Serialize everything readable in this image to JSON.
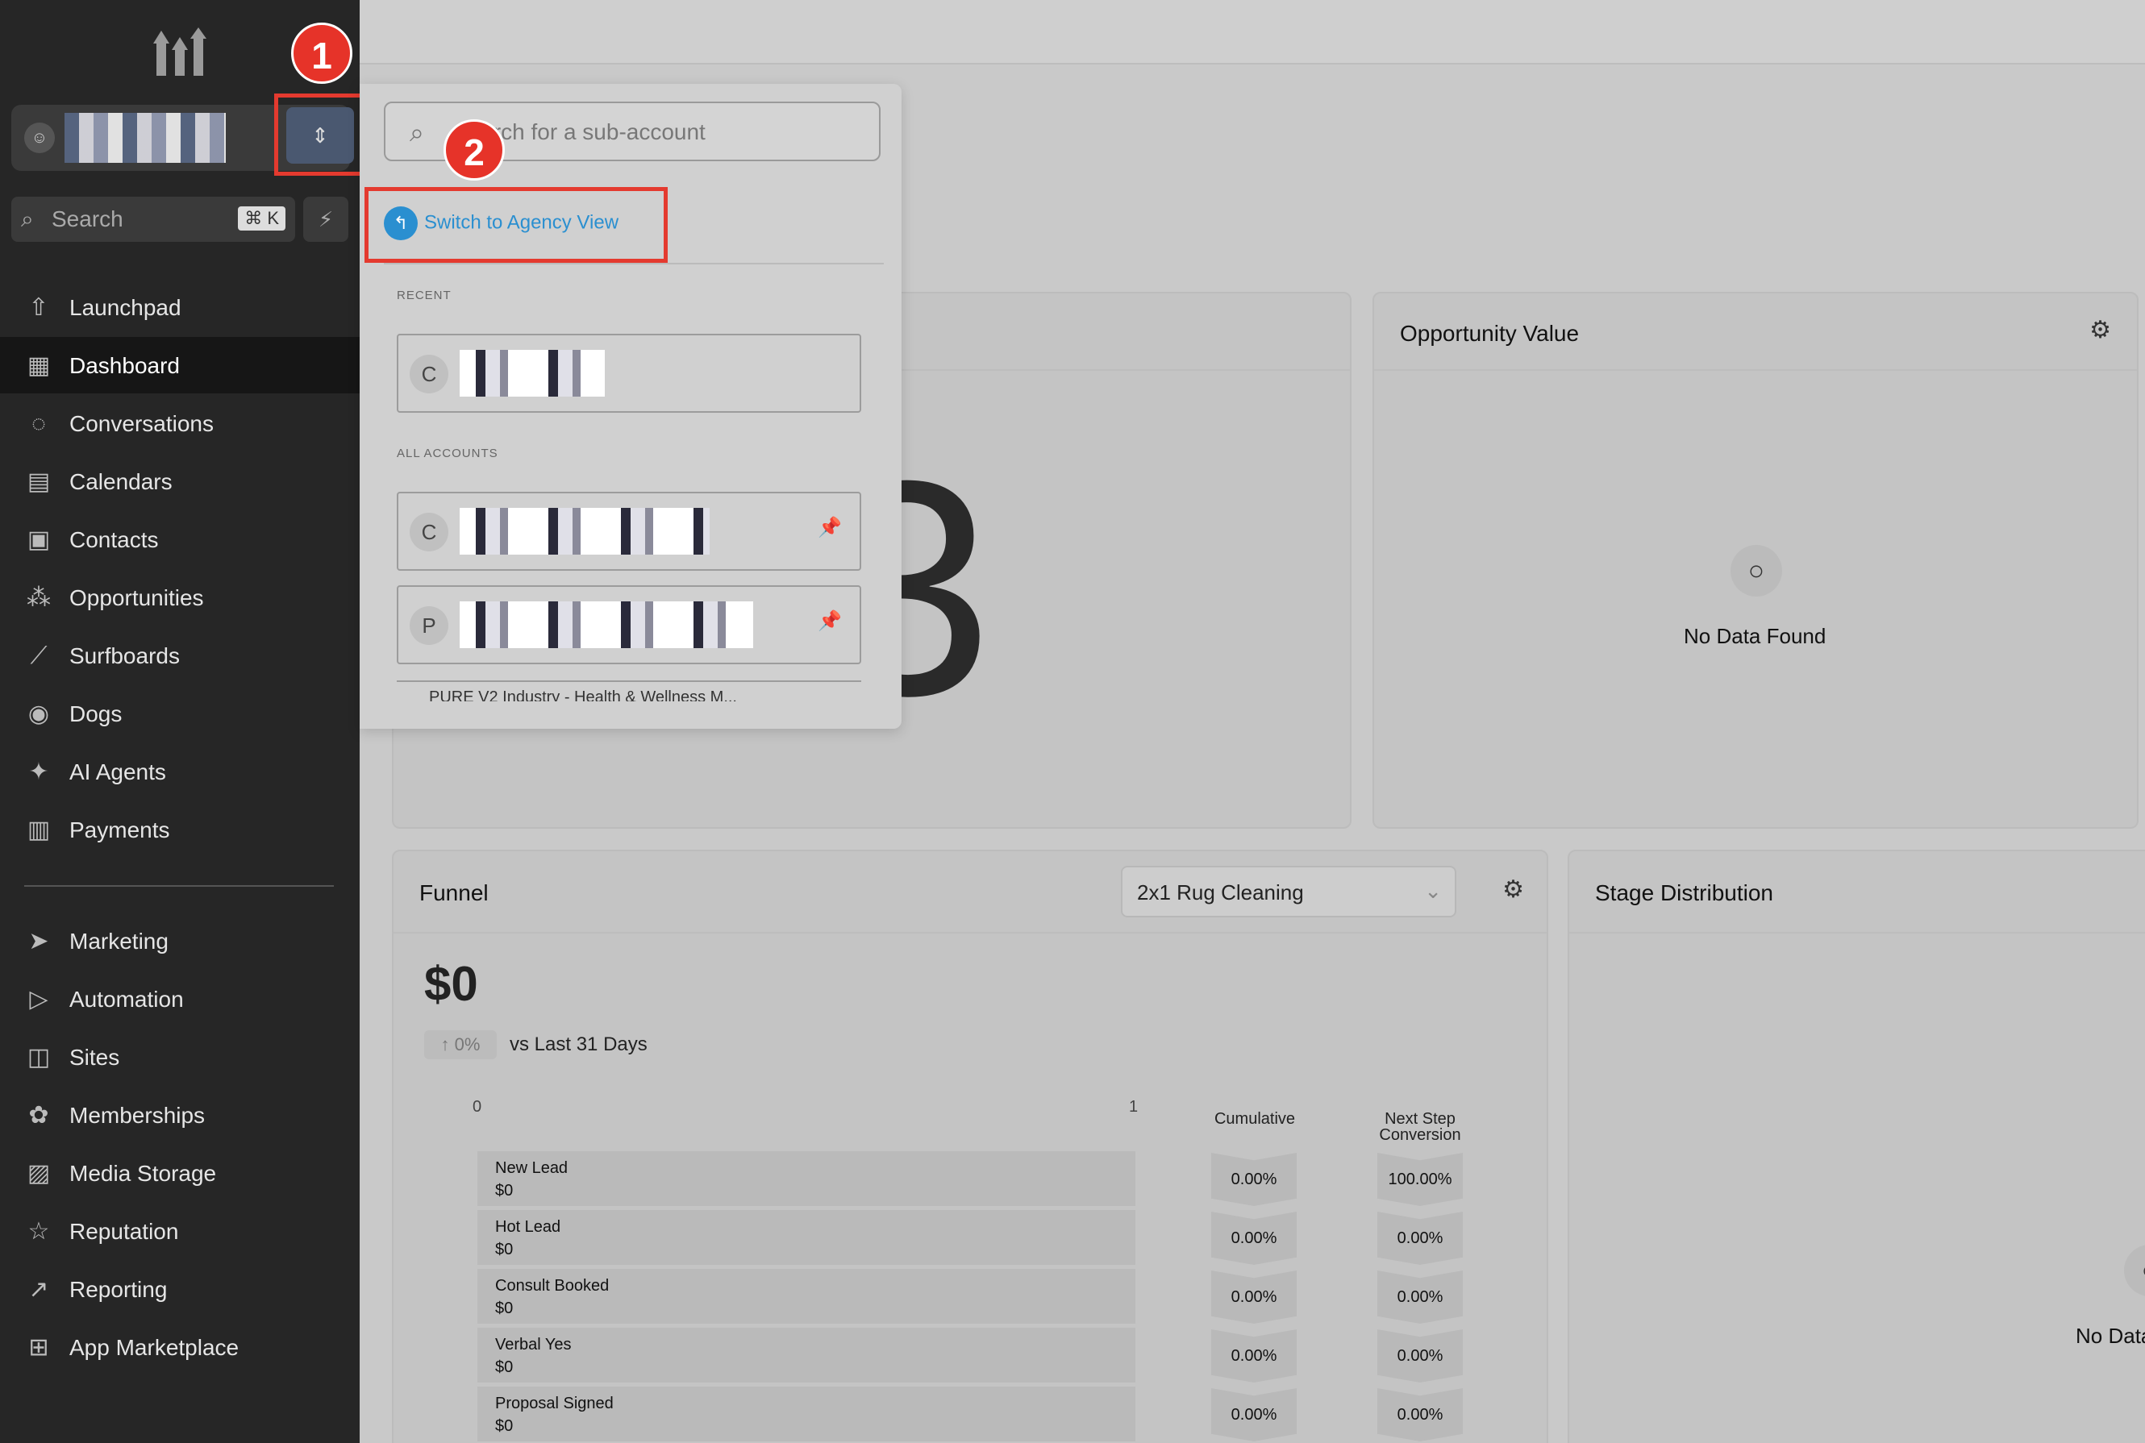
{
  "sidebar": {
    "search": {
      "placeholder": "Search",
      "shortcut": "⌘ K"
    },
    "nav_top": [
      {
        "label": "Launchpad",
        "icon": "rocket-icon"
      },
      {
        "label": "Dashboard",
        "icon": "grid-icon",
        "active": true
      },
      {
        "label": "Conversations",
        "icon": "chat-icon"
      },
      {
        "label": "Calendars",
        "icon": "calendar-icon"
      },
      {
        "label": "Contacts",
        "icon": "contacts-icon"
      },
      {
        "label": "Opportunities",
        "icon": "opportunities-icon"
      },
      {
        "label": "Surfboards",
        "icon": "surfboard-icon"
      },
      {
        "label": "Dogs",
        "icon": "dog-icon"
      },
      {
        "label": "AI Agents",
        "icon": "sparkle-icon"
      },
      {
        "label": "Payments",
        "icon": "payments-icon"
      }
    ],
    "nav_bottom": [
      {
        "label": "Marketing",
        "icon": "send-icon"
      },
      {
        "label": "Automation",
        "icon": "automation-icon"
      },
      {
        "label": "Sites",
        "icon": "sites-icon"
      },
      {
        "label": "Memberships",
        "icon": "badge-icon"
      },
      {
        "label": "Media Storage",
        "icon": "image-icon"
      },
      {
        "label": "Reputation",
        "icon": "star-icon"
      },
      {
        "label": "Reporting",
        "icon": "trend-icon"
      },
      {
        "label": "App Marketplace",
        "icon": "apps-icon"
      }
    ]
  },
  "annotations": {
    "badge1": "1",
    "badge2": "2"
  },
  "popover": {
    "search_placeholder": "Search for a sub-account",
    "agency_button": "Switch to Agency View",
    "recent_label": "RECENT",
    "all_label": "ALL ACCOUNTS",
    "recent": [
      {
        "letter": "C"
      }
    ],
    "all": [
      {
        "letter": "C"
      },
      {
        "letter": "P"
      }
    ],
    "cut_off_text": "PURE V2 Industry - Health & Wellness M..."
  },
  "cards": {
    "left_big_number": "3",
    "opportunity_value": {
      "title": "Opportunity Value",
      "empty": "No Data Found"
    },
    "stage_distribution": {
      "title": "Stage Distribution",
      "empty": "No Data"
    }
  },
  "funnel": {
    "title": "Funnel",
    "pipeline": "2x1 Rug Cleaning",
    "amount": "$0",
    "change": "0%",
    "compare": "vs Last 31 Days",
    "axis": [
      "0",
      "1"
    ],
    "col_cumulative": "Cumulative",
    "col_next": "Next Step Conversion",
    "stages": [
      {
        "name": "New Lead",
        "amount": "$0",
        "cumulative": "0.00%",
        "next": "100.00%"
      },
      {
        "name": "Hot Lead",
        "amount": "$0",
        "cumulative": "0.00%",
        "next": "0.00%"
      },
      {
        "name": "Consult Booked",
        "amount": "$0",
        "cumulative": "0.00%",
        "next": "0.00%"
      },
      {
        "name": "Verbal Yes",
        "amount": "$0",
        "cumulative": "0.00%",
        "next": "0.00%"
      },
      {
        "name": "Proposal Signed",
        "amount": "$0",
        "cumulative": "0.00%",
        "next": "0.00%"
      }
    ]
  },
  "colors": {
    "sidebar": "#262626",
    "accent": "#2a8fd0",
    "annotation": "#e43a2f"
  }
}
